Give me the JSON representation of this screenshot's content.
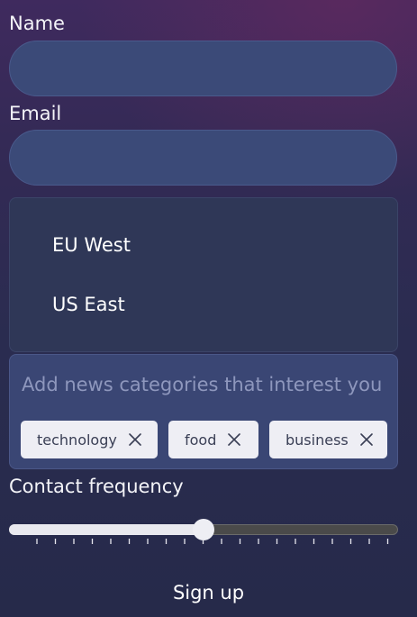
{
  "form": {
    "name_label": "Name",
    "name_value": "",
    "email_label": "Email",
    "email_value": "",
    "region_options": [
      "EU West",
      "US East"
    ],
    "categories": {
      "placeholder": "Add news categories that interest you",
      "tags": [
        "technology",
        "food",
        "business"
      ]
    },
    "contact_frequency_label": "Contact frequency",
    "contact_frequency_value": 0.5,
    "submit_label": "Sign up"
  },
  "icons": {
    "tag_remove": "close-icon"
  }
}
